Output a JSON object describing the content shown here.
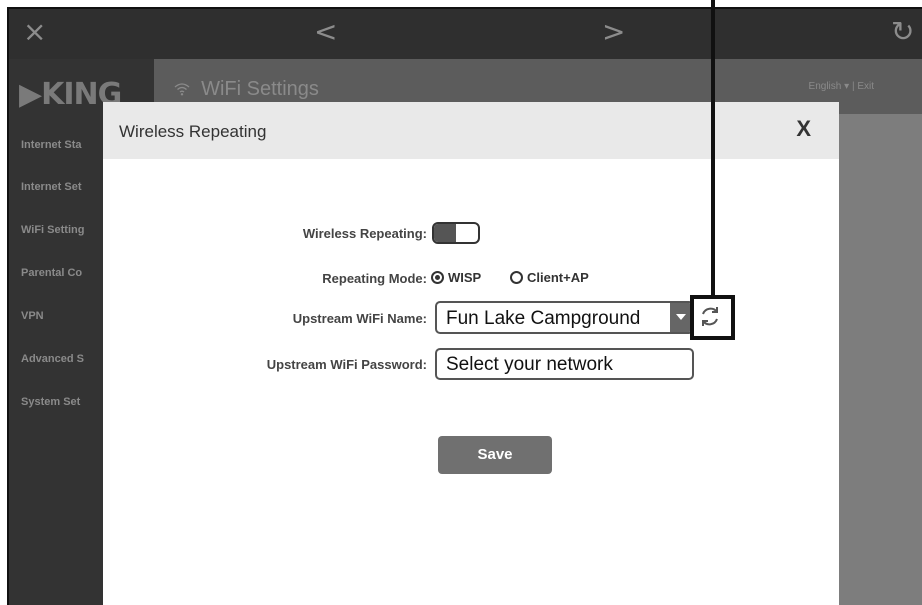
{
  "topbar": {
    "close_icon": "×",
    "back_icon": "<",
    "forward_icon": ">",
    "reload_icon": "↻"
  },
  "app": {
    "logo": "▶KING",
    "nav": [
      "Internet Sta",
      "Internet Set",
      "WiFi Setting",
      "Parental Co",
      "VPN",
      "Advanced S",
      "System Set"
    ],
    "header_title": "WiFi Settings",
    "wifi_icon": "wifi-icon",
    "language": "English",
    "exit": "Exit"
  },
  "modal": {
    "title": "Wireless Repeating",
    "close_label": "X",
    "repeating_label": "Wireless Repeating:",
    "repeating_on": false,
    "mode_label": "Repeating Mode:",
    "mode_options": [
      "WISP",
      "Client+AP"
    ],
    "mode_selected": "WISP",
    "upstream_name_label": "Upstream WiFi Name:",
    "upstream_name_value": "Fun Lake Campground",
    "upstream_password_label": "Upstream WiFi Password:",
    "upstream_password_placeholder": "Select your network",
    "save_label": "Save",
    "refresh_icon": "refresh-icon"
  },
  "colors": {
    "overlay": "#7d7d7d",
    "sidebar": "#333333",
    "toggle_knob": "#555555",
    "save_button": "#707070",
    "callout": "#111111"
  }
}
